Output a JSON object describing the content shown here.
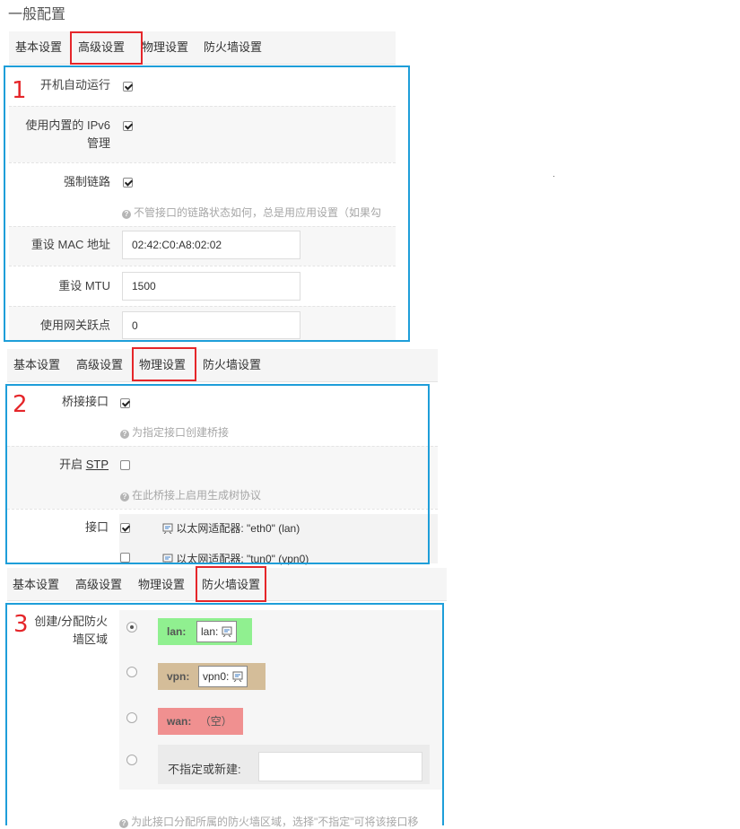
{
  "page_title": "一般配置",
  "tabs": [
    "基本设置",
    "高级设置",
    "物理设置",
    "防火墙设置"
  ],
  "markers": [
    "1",
    "2",
    "3"
  ],
  "colors": {
    "annotation_red": "#e5262a",
    "annotation_blue": "#1e9ed9",
    "zone_lan": "#90f090",
    "zone_vpn": "#d4bd99",
    "zone_wan": "#f09090"
  },
  "advanced": {
    "autostart_label": "开机自动运行",
    "ipv6_label": "使用内置的 IPv6 管理",
    "force_link_label": "强制链路",
    "force_link_hint": "不管接口的链路状态如何，总是用应用设置（如果勾",
    "mac_label": "重设 MAC 地址",
    "mac_value": "02:42:C0:A8:02:02",
    "mtu_label": "重设 MTU",
    "mtu_value": "1500",
    "metric_label": "使用网关跃点",
    "metric_value": "0"
  },
  "physical": {
    "bridge_label": "桥接接口",
    "bridge_hint": "为指定接口创建桥接",
    "stp_label_prefix": "开启 ",
    "stp_label_link": "STP",
    "stp_hint": "在此桥接上启用生成树协议",
    "iface_label": "接口",
    "ifaces": [
      "以太网适配器: \"eth0\" (lan)",
      "以太网适配器: \"tun0\" (vpn0)"
    ]
  },
  "firewall": {
    "zone_label": "创建/分配防火墙区域",
    "zones": [
      {
        "name": "lan:",
        "box": "lan:"
      },
      {
        "name": "vpn:",
        "box": "vpn0:"
      },
      {
        "name": "wan:",
        "empty": "（空）"
      }
    ],
    "custom_label": "不指定或新建:",
    "hint": "为此接口分配所属的防火墙区域，选择\"不指定\"可将该接口移"
  }
}
